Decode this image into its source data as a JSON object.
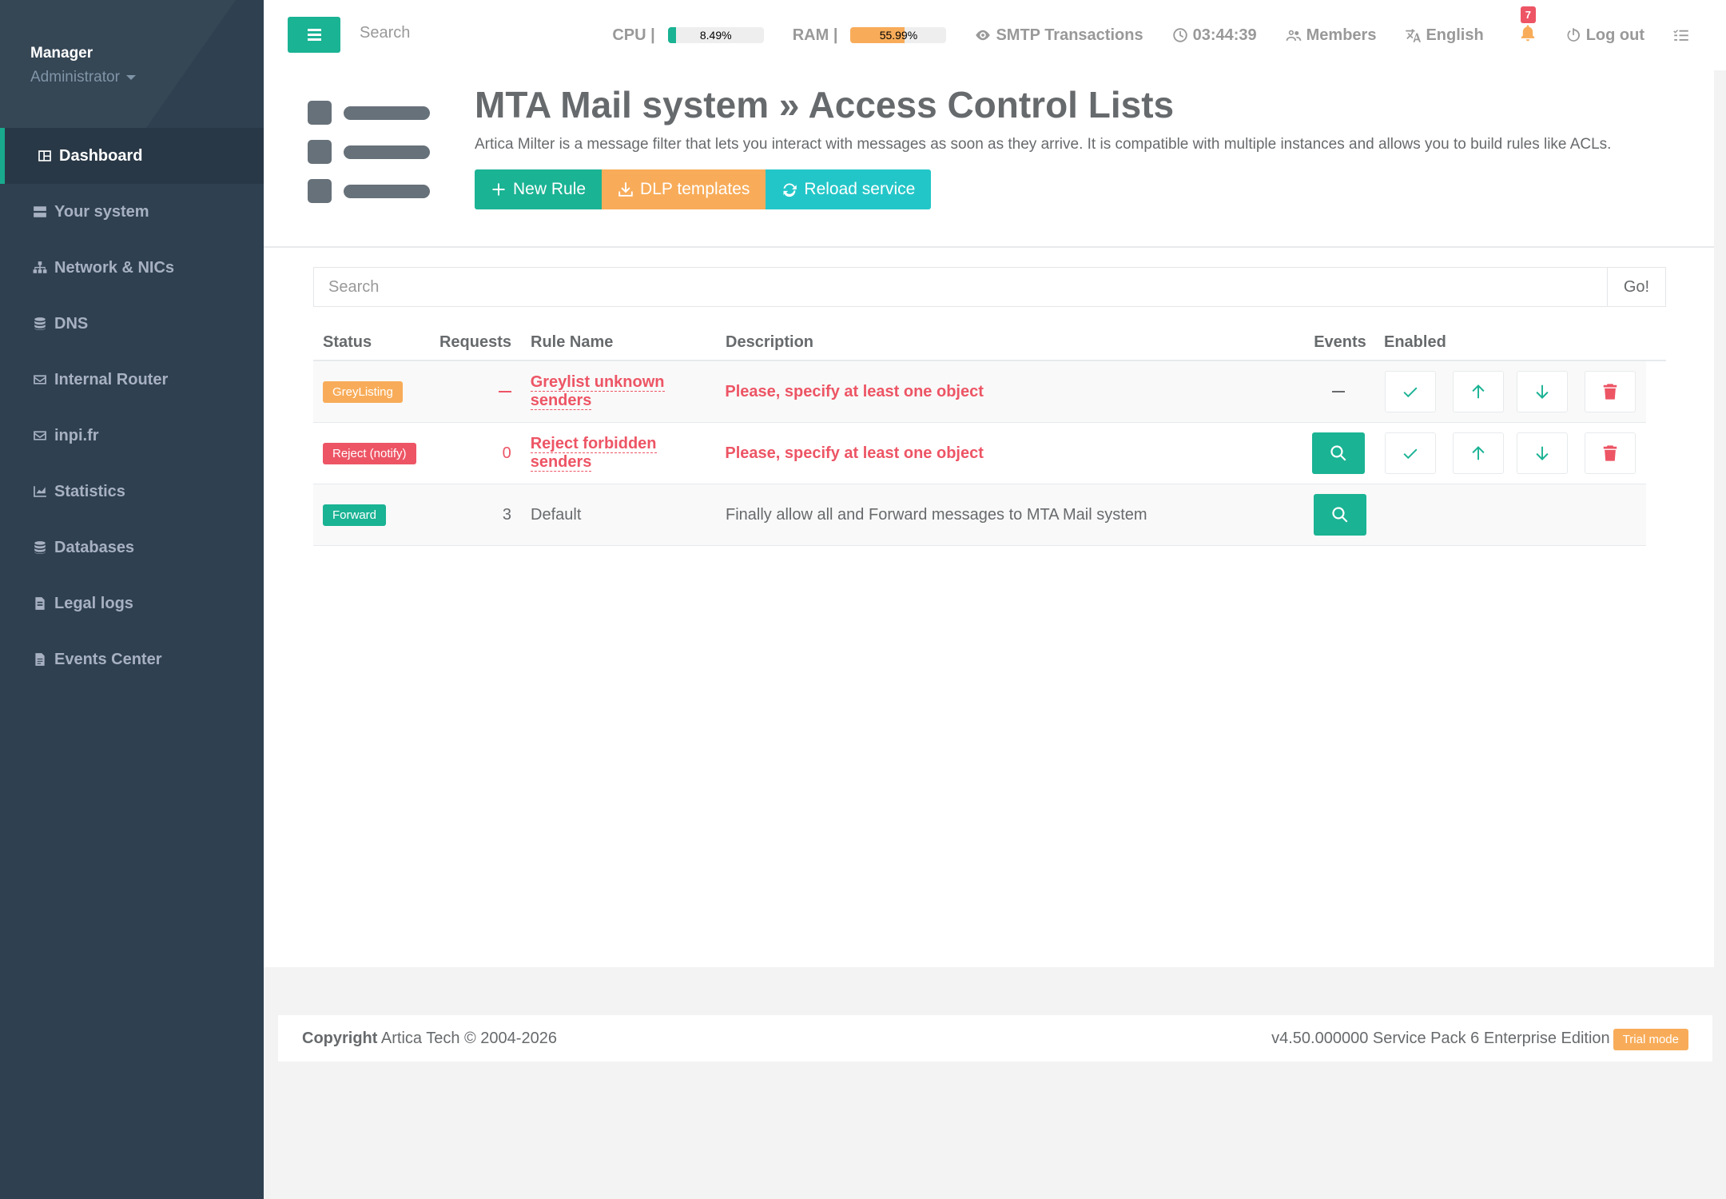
{
  "profile": {
    "name": "Manager",
    "role": "Administrator"
  },
  "sidebar": {
    "items": [
      {
        "label": "Dashboard",
        "icon": "dashboard-icon",
        "active": true
      },
      {
        "label": "Your system",
        "icon": "server-icon"
      },
      {
        "label": "Network & NICs",
        "icon": "network-icon"
      },
      {
        "label": "DNS",
        "icon": "database-icon"
      },
      {
        "label": "Internal Router",
        "icon": "envelope-icon"
      },
      {
        "label": "inpi.fr",
        "icon": "envelope-icon"
      },
      {
        "label": "Statistics",
        "icon": "chart-icon"
      },
      {
        "label": "Databases",
        "icon": "database-icon"
      },
      {
        "label": "Legal logs",
        "icon": "file-icon"
      },
      {
        "label": "Events Center",
        "icon": "file-text-icon"
      }
    ]
  },
  "topbar": {
    "search_placeholder": "Search",
    "cpu_label": "CPU |",
    "cpu_value": "8.49%",
    "cpu_percent": 8.49,
    "ram_label": "RAM |",
    "ram_value": "55.99%",
    "ram_percent": 55.99,
    "smtp": "SMTP Transactions",
    "clock": "03:44:39",
    "members": "Members",
    "language": "English",
    "notifications": "7",
    "logout": "Log out"
  },
  "header": {
    "title": "MTA Mail system » Access Control Lists",
    "subtitle": "Artica Milter is a message filter that lets you interact with messages as soon as they arrive. It is compatible with multiple instances and allows you to build rules like ACLs.",
    "buttons": {
      "new_rule": "New Rule",
      "dlp": "DLP templates",
      "reload": "Reload service"
    }
  },
  "search": {
    "placeholder": "Search",
    "go": "Go!"
  },
  "table": {
    "columns": {
      "status": "Status",
      "requests": "Requests",
      "name": "Rule Name",
      "description": "Description",
      "events": "Events",
      "enabled": "Enabled"
    },
    "rows": [
      {
        "status": "GreyListing",
        "requests": "",
        "name": "Greylist unknown senders",
        "description": "Please, specify at least one object"
      },
      {
        "status": "Reject (notify)",
        "requests": "0",
        "name": "Reject forbidden senders",
        "description": "Please, specify at least one object"
      },
      {
        "status": "Forward",
        "requests": "3",
        "name": "Default",
        "description": "Finally allow all and Forward messages to MTA Mail system"
      }
    ]
  },
  "footer": {
    "copyright_label": "Copyright",
    "copyright_text": "Artica Tech © 2004-2026",
    "version": "v4.50.000000 Service Pack 6 Enterprise Edition",
    "trial": "Trial mode"
  },
  "colors": {
    "primary": "#1ab394",
    "warning": "#f8ac59",
    "danger": "#ed5565",
    "info": "#23c6c8",
    "sidebar": "#2f4050"
  }
}
